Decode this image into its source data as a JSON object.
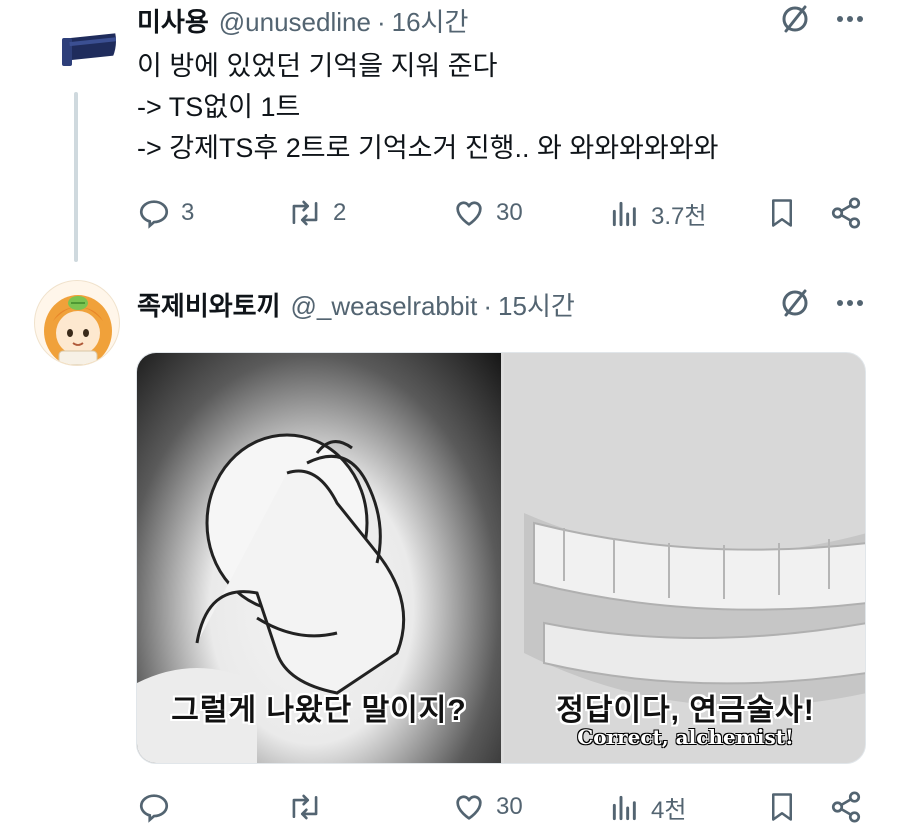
{
  "tweet1": {
    "name": "미사용",
    "handle": "@unusedline",
    "separator": "·",
    "time": "16시간",
    "lines": [
      "이 방에 있었던 기억을 지워 준다",
      "-> TS없이 1트",
      "-> 강제TS후 2트로 기억소거 진행.. 와 와와와와와와"
    ],
    "actions": {
      "replies": "3",
      "retweets": "2",
      "likes": "30",
      "views": "3.7천"
    }
  },
  "tweet2": {
    "name": "족제비와토끼",
    "handle": "@_weaselrabbit",
    "separator": "·",
    "time": "15시간",
    "media": {
      "left_caption": "그럴게 나왔단 말이지?",
      "right_caption_ko": "정답이다, 연금술사!",
      "right_caption_en": "Correct, alchemist!"
    },
    "actions": {
      "replies": "",
      "retweets": "",
      "likes": "30",
      "views": "4천"
    }
  },
  "colors": {
    "text": "#0f1419",
    "secondary": "#536471",
    "thread": "#cfd9de"
  },
  "icons": [
    "grok-icon",
    "more-icon",
    "reply-icon",
    "retweet-icon",
    "like-icon",
    "views-icon",
    "bookmark-icon",
    "share-icon"
  ]
}
